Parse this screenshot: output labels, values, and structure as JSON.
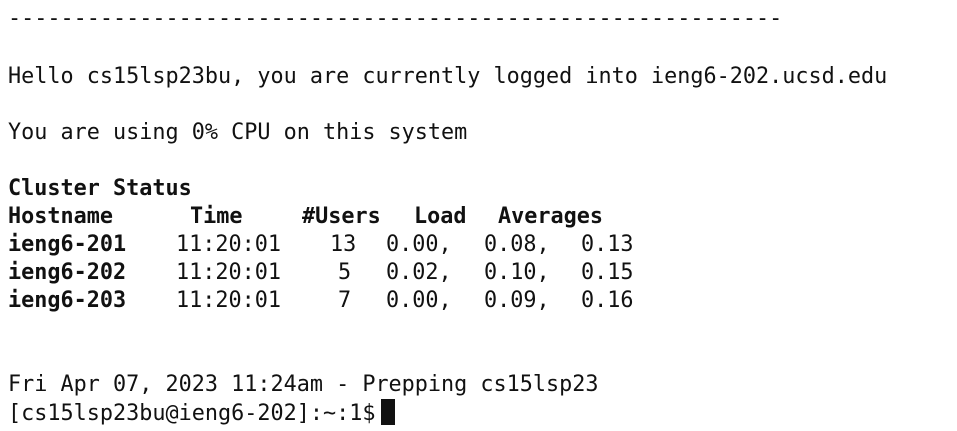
{
  "separator": "-----------------------------------------------------------",
  "greeting": "Hello cs15lsp23bu, you are currently logged into ieng6-202.ucsd.edu",
  "cpu_usage": "You are using 0% CPU on this system",
  "cluster": {
    "title": "Cluster Status",
    "headers": {
      "hostname": "Hostname",
      "time": "Time",
      "users": "#Users",
      "load": "Load",
      "averages": "Averages"
    },
    "rows": [
      {
        "host": "ieng6-201",
        "time": "11:20:01",
        "users": "13",
        "l1": "0.00,",
        "l2": "0.08,",
        "l3": "0.13"
      },
      {
        "host": "ieng6-202",
        "time": "11:20:01",
        "users": "5",
        "l1": "0.02,",
        "l2": "0.10,",
        "l3": "0.15"
      },
      {
        "host": "ieng6-203",
        "time": "11:20:01",
        "users": "7",
        "l1": "0.00,",
        "l2": "0.09,",
        "l3": "0.16"
      }
    ]
  },
  "status_line": "Fri Apr 07, 2023 11:24am - Prepping cs15lsp23",
  "prompt": "[cs15lsp23bu@ieng6-202]:~:1$"
}
